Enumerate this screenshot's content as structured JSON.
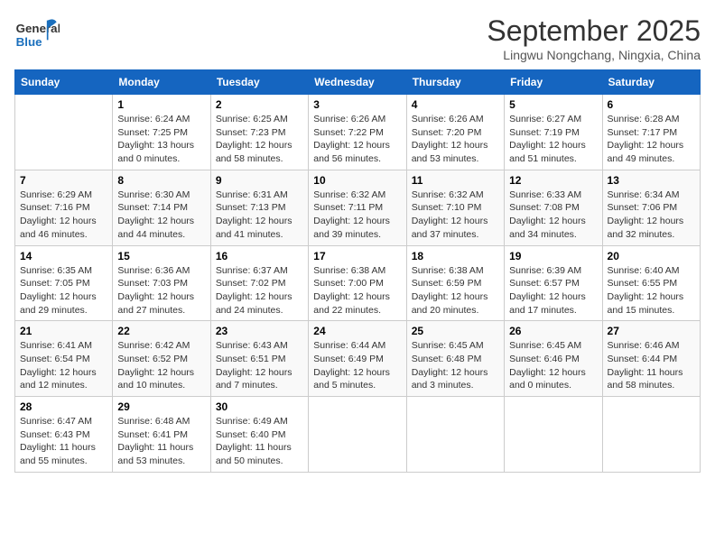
{
  "header": {
    "logo_line1": "General",
    "logo_line2": "Blue",
    "month": "September 2025",
    "location": "Lingwu Nongchang, Ningxia, China"
  },
  "days_of_week": [
    "Sunday",
    "Monday",
    "Tuesday",
    "Wednesday",
    "Thursday",
    "Friday",
    "Saturday"
  ],
  "weeks": [
    [
      {
        "day": "",
        "info": ""
      },
      {
        "day": "1",
        "info": "Sunrise: 6:24 AM\nSunset: 7:25 PM\nDaylight: 13 hours\nand 0 minutes."
      },
      {
        "day": "2",
        "info": "Sunrise: 6:25 AM\nSunset: 7:23 PM\nDaylight: 12 hours\nand 58 minutes."
      },
      {
        "day": "3",
        "info": "Sunrise: 6:26 AM\nSunset: 7:22 PM\nDaylight: 12 hours\nand 56 minutes."
      },
      {
        "day": "4",
        "info": "Sunrise: 6:26 AM\nSunset: 7:20 PM\nDaylight: 12 hours\nand 53 minutes."
      },
      {
        "day": "5",
        "info": "Sunrise: 6:27 AM\nSunset: 7:19 PM\nDaylight: 12 hours\nand 51 minutes."
      },
      {
        "day": "6",
        "info": "Sunrise: 6:28 AM\nSunset: 7:17 PM\nDaylight: 12 hours\nand 49 minutes."
      }
    ],
    [
      {
        "day": "7",
        "info": "Sunrise: 6:29 AM\nSunset: 7:16 PM\nDaylight: 12 hours\nand 46 minutes."
      },
      {
        "day": "8",
        "info": "Sunrise: 6:30 AM\nSunset: 7:14 PM\nDaylight: 12 hours\nand 44 minutes."
      },
      {
        "day": "9",
        "info": "Sunrise: 6:31 AM\nSunset: 7:13 PM\nDaylight: 12 hours\nand 41 minutes."
      },
      {
        "day": "10",
        "info": "Sunrise: 6:32 AM\nSunset: 7:11 PM\nDaylight: 12 hours\nand 39 minutes."
      },
      {
        "day": "11",
        "info": "Sunrise: 6:32 AM\nSunset: 7:10 PM\nDaylight: 12 hours\nand 37 minutes."
      },
      {
        "day": "12",
        "info": "Sunrise: 6:33 AM\nSunset: 7:08 PM\nDaylight: 12 hours\nand 34 minutes."
      },
      {
        "day": "13",
        "info": "Sunrise: 6:34 AM\nSunset: 7:06 PM\nDaylight: 12 hours\nand 32 minutes."
      }
    ],
    [
      {
        "day": "14",
        "info": "Sunrise: 6:35 AM\nSunset: 7:05 PM\nDaylight: 12 hours\nand 29 minutes."
      },
      {
        "day": "15",
        "info": "Sunrise: 6:36 AM\nSunset: 7:03 PM\nDaylight: 12 hours\nand 27 minutes."
      },
      {
        "day": "16",
        "info": "Sunrise: 6:37 AM\nSunset: 7:02 PM\nDaylight: 12 hours\nand 24 minutes."
      },
      {
        "day": "17",
        "info": "Sunrise: 6:38 AM\nSunset: 7:00 PM\nDaylight: 12 hours\nand 22 minutes."
      },
      {
        "day": "18",
        "info": "Sunrise: 6:38 AM\nSunset: 6:59 PM\nDaylight: 12 hours\nand 20 minutes."
      },
      {
        "day": "19",
        "info": "Sunrise: 6:39 AM\nSunset: 6:57 PM\nDaylight: 12 hours\nand 17 minutes."
      },
      {
        "day": "20",
        "info": "Sunrise: 6:40 AM\nSunset: 6:55 PM\nDaylight: 12 hours\nand 15 minutes."
      }
    ],
    [
      {
        "day": "21",
        "info": "Sunrise: 6:41 AM\nSunset: 6:54 PM\nDaylight: 12 hours\nand 12 minutes."
      },
      {
        "day": "22",
        "info": "Sunrise: 6:42 AM\nSunset: 6:52 PM\nDaylight: 12 hours\nand 10 minutes."
      },
      {
        "day": "23",
        "info": "Sunrise: 6:43 AM\nSunset: 6:51 PM\nDaylight: 12 hours\nand 7 minutes."
      },
      {
        "day": "24",
        "info": "Sunrise: 6:44 AM\nSunset: 6:49 PM\nDaylight: 12 hours\nand 5 minutes."
      },
      {
        "day": "25",
        "info": "Sunrise: 6:45 AM\nSunset: 6:48 PM\nDaylight: 12 hours\nand 3 minutes."
      },
      {
        "day": "26",
        "info": "Sunrise: 6:45 AM\nSunset: 6:46 PM\nDaylight: 12 hours\nand 0 minutes."
      },
      {
        "day": "27",
        "info": "Sunrise: 6:46 AM\nSunset: 6:44 PM\nDaylight: 11 hours\nand 58 minutes."
      }
    ],
    [
      {
        "day": "28",
        "info": "Sunrise: 6:47 AM\nSunset: 6:43 PM\nDaylight: 11 hours\nand 55 minutes."
      },
      {
        "day": "29",
        "info": "Sunrise: 6:48 AM\nSunset: 6:41 PM\nDaylight: 11 hours\nand 53 minutes."
      },
      {
        "day": "30",
        "info": "Sunrise: 6:49 AM\nSunset: 6:40 PM\nDaylight: 11 hours\nand 50 minutes."
      },
      {
        "day": "",
        "info": ""
      },
      {
        "day": "",
        "info": ""
      },
      {
        "day": "",
        "info": ""
      },
      {
        "day": "",
        "info": ""
      }
    ]
  ]
}
